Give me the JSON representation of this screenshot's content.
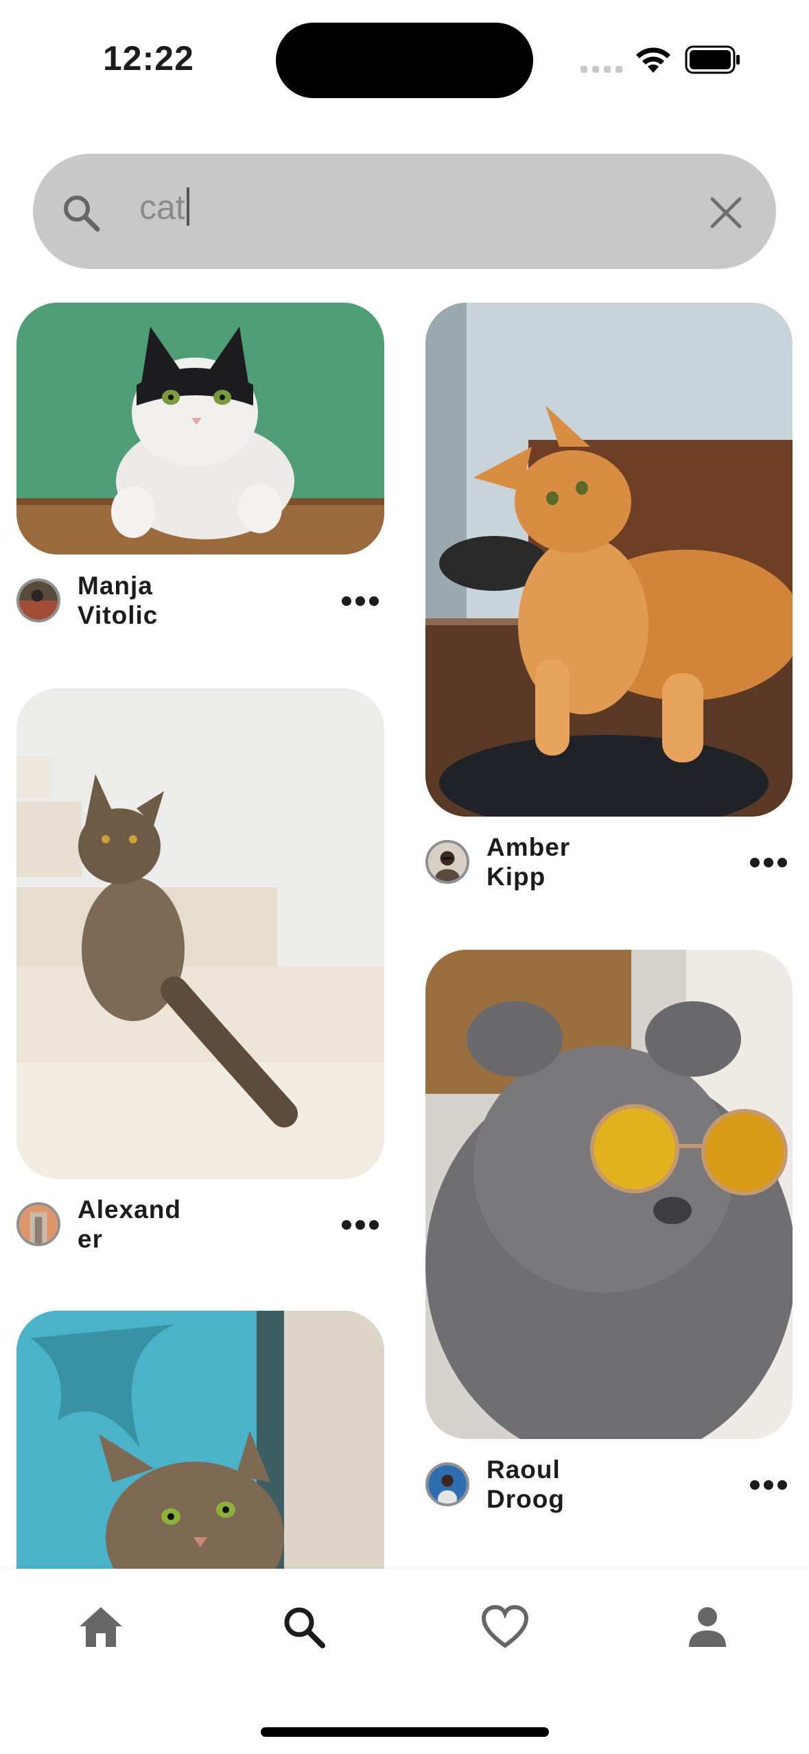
{
  "status": {
    "time": "12:22"
  },
  "search": {
    "query": "cat"
  },
  "pins": [
    {
      "author_line1": "Manja",
      "author_line2": "Vitolic",
      "image": "tuxedo cat on green background"
    },
    {
      "author_line1": "Amber",
      "author_line2": "Kipp",
      "image": "orange maine coon cat lying on table"
    },
    {
      "author_line1": "Alexand",
      "author_line2": "er",
      "image": "tabby cat sitting on stairs"
    },
    {
      "author_line1": "Raoul",
      "author_line2": "Droog",
      "image": "grey scottish fold cat wearing sunglasses"
    },
    {
      "author_line1": "",
      "author_line2": "",
      "image": "tabby cat peeking from door"
    }
  ],
  "nav": {
    "items": [
      "home-icon",
      "search-icon",
      "heart-icon",
      "profile-icon"
    ],
    "active": "search-icon"
  },
  "colors": {
    "search_bg": "#c8c8c8",
    "icon_grey": "#666666",
    "active_icon": "#1c1c1e"
  }
}
